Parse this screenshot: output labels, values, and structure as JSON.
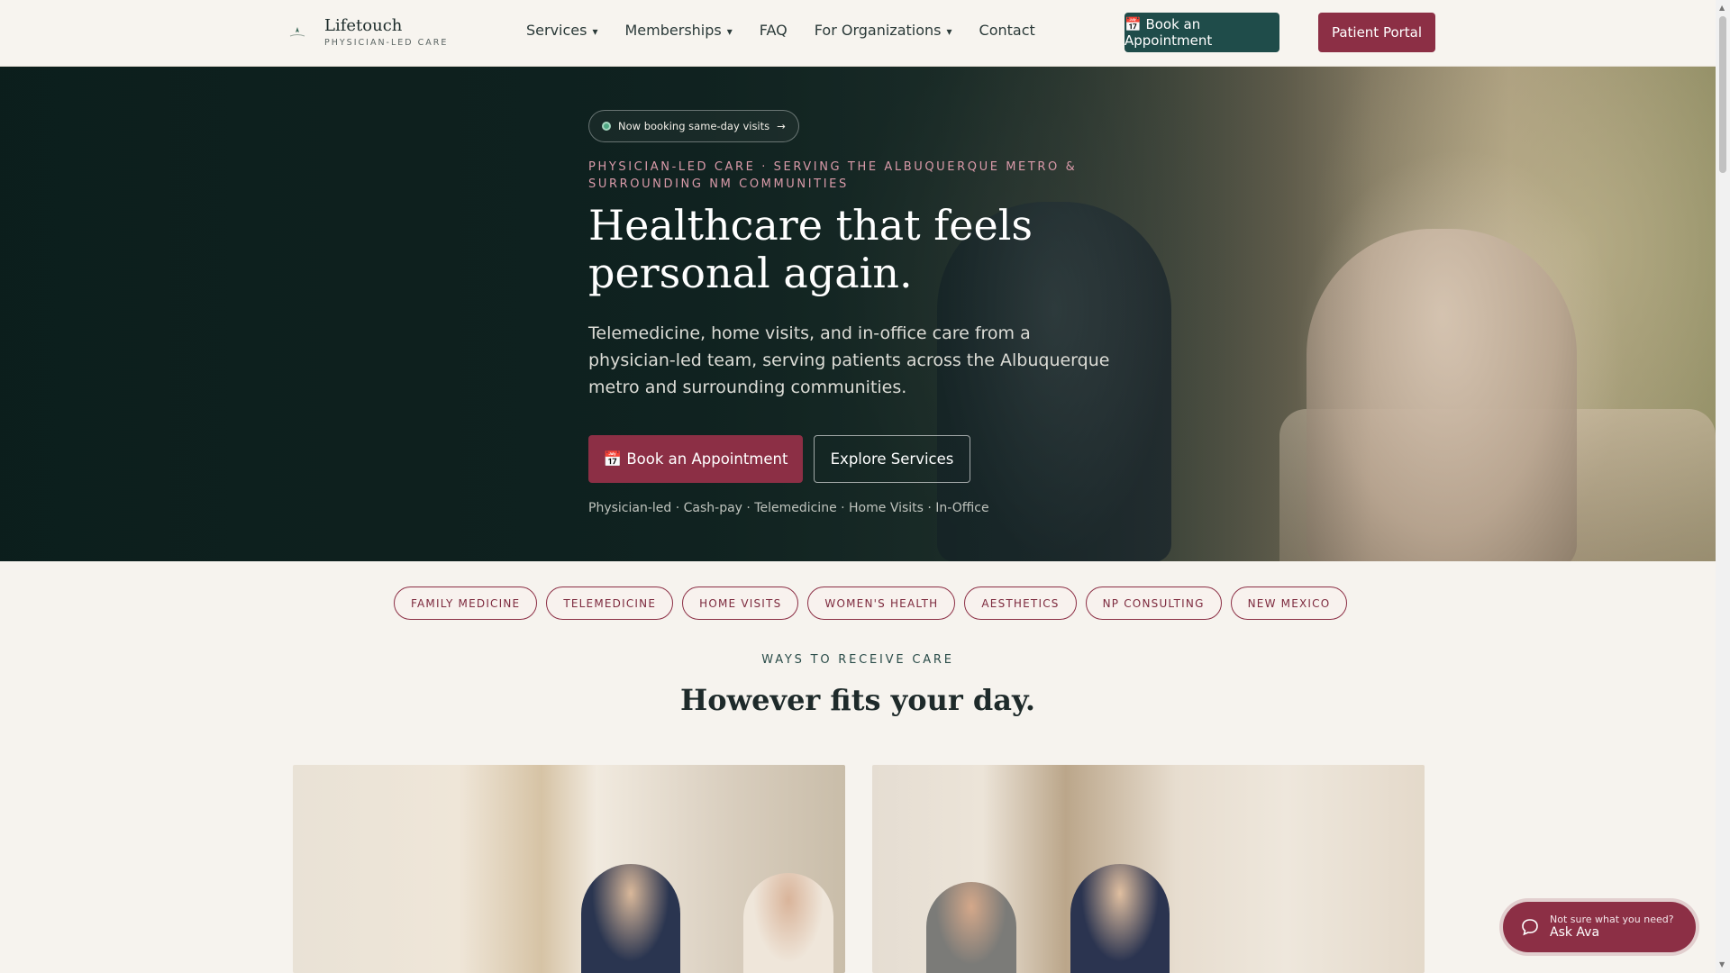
{
  "brand": {
    "name": "Lifetouch",
    "tagline": "PHYSICIAN-LED CARE"
  },
  "nav": {
    "links": [
      {
        "label": "Services",
        "caret": "▾"
      },
      {
        "label": "Memberships",
        "caret": "▾"
      },
      {
        "label": "FAQ",
        "caret": ""
      },
      {
        "label": "For Organizations",
        "caret": "▾"
      },
      {
        "label": "Contact",
        "caret": ""
      }
    ],
    "book_label": "📅 Book an Appointment",
    "portal_label": "Patient Portal"
  },
  "hero": {
    "badge": "Now booking same-day visits",
    "badge_arrow": "→",
    "eyebrow": "PHYSICIAN-LED CARE · SERVING THE ALBUQUERQUE METRO & SURROUNDING NM COMMUNITIES",
    "title": "Healthcare that feels personal again.",
    "subtitle": "Telemedicine, home visits, and in-office care from a physician-led team, serving patients across the Albuquerque metro and surrounding communities.",
    "book_label": "📅 Book an Appointment",
    "explore_label": "Explore Services",
    "tags": "Physician-led · Cash-pay · Telemedicine · Home Visits · In-Office"
  },
  "chips": [
    "FAMILY MEDICINE",
    "TELEMEDICINE",
    "HOME VISITS",
    "WOMEN'S HEALTH",
    "AESTHETICS",
    "NP CONSULTING",
    "NEW MEXICO"
  ],
  "section": {
    "eyebrow": "WAYS TO RECEIVE CARE",
    "title": "However fits your day."
  },
  "chat": {
    "question": "Not sure what you need?",
    "name": "Ask Ava"
  },
  "colors": {
    "brand_green": "#1f4c4a",
    "brand_burgundy": "#8c2f45",
    "page_bg": "#f6f3ee"
  }
}
